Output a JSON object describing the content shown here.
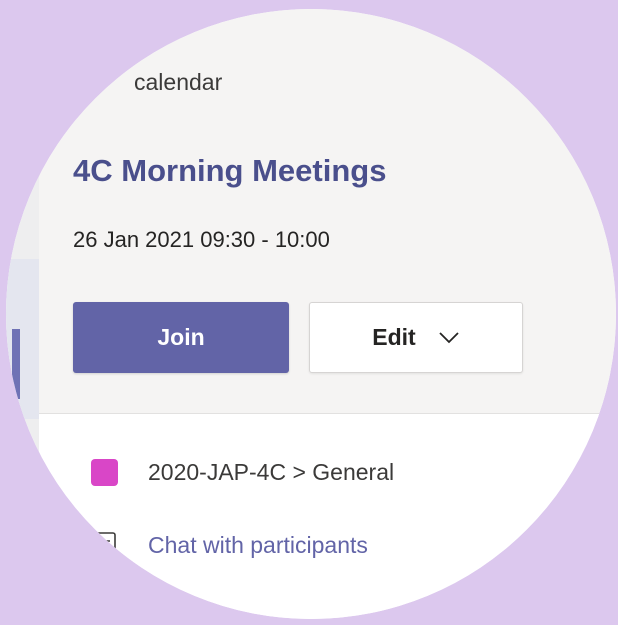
{
  "panel": {
    "calendar_label": "calendar"
  },
  "meeting": {
    "title": "4C Morning Meetings",
    "datetime": "26 Jan 2021 09:30 - 10:00"
  },
  "actions": {
    "join_label": "Join",
    "edit_label": "Edit"
  },
  "details": {
    "channel_label": "2020-JAP-4C > General",
    "chat_label": "Chat with participants"
  },
  "icons": {
    "channel": "team-channel-icon",
    "chat": "chat-icon",
    "edit_dropdown": "chevron-down-icon"
  },
  "colors": {
    "background": "#dcc8ee",
    "brand": "#6264a7",
    "title": "#4a4f8c",
    "channel_avatar": "#d946c7"
  }
}
